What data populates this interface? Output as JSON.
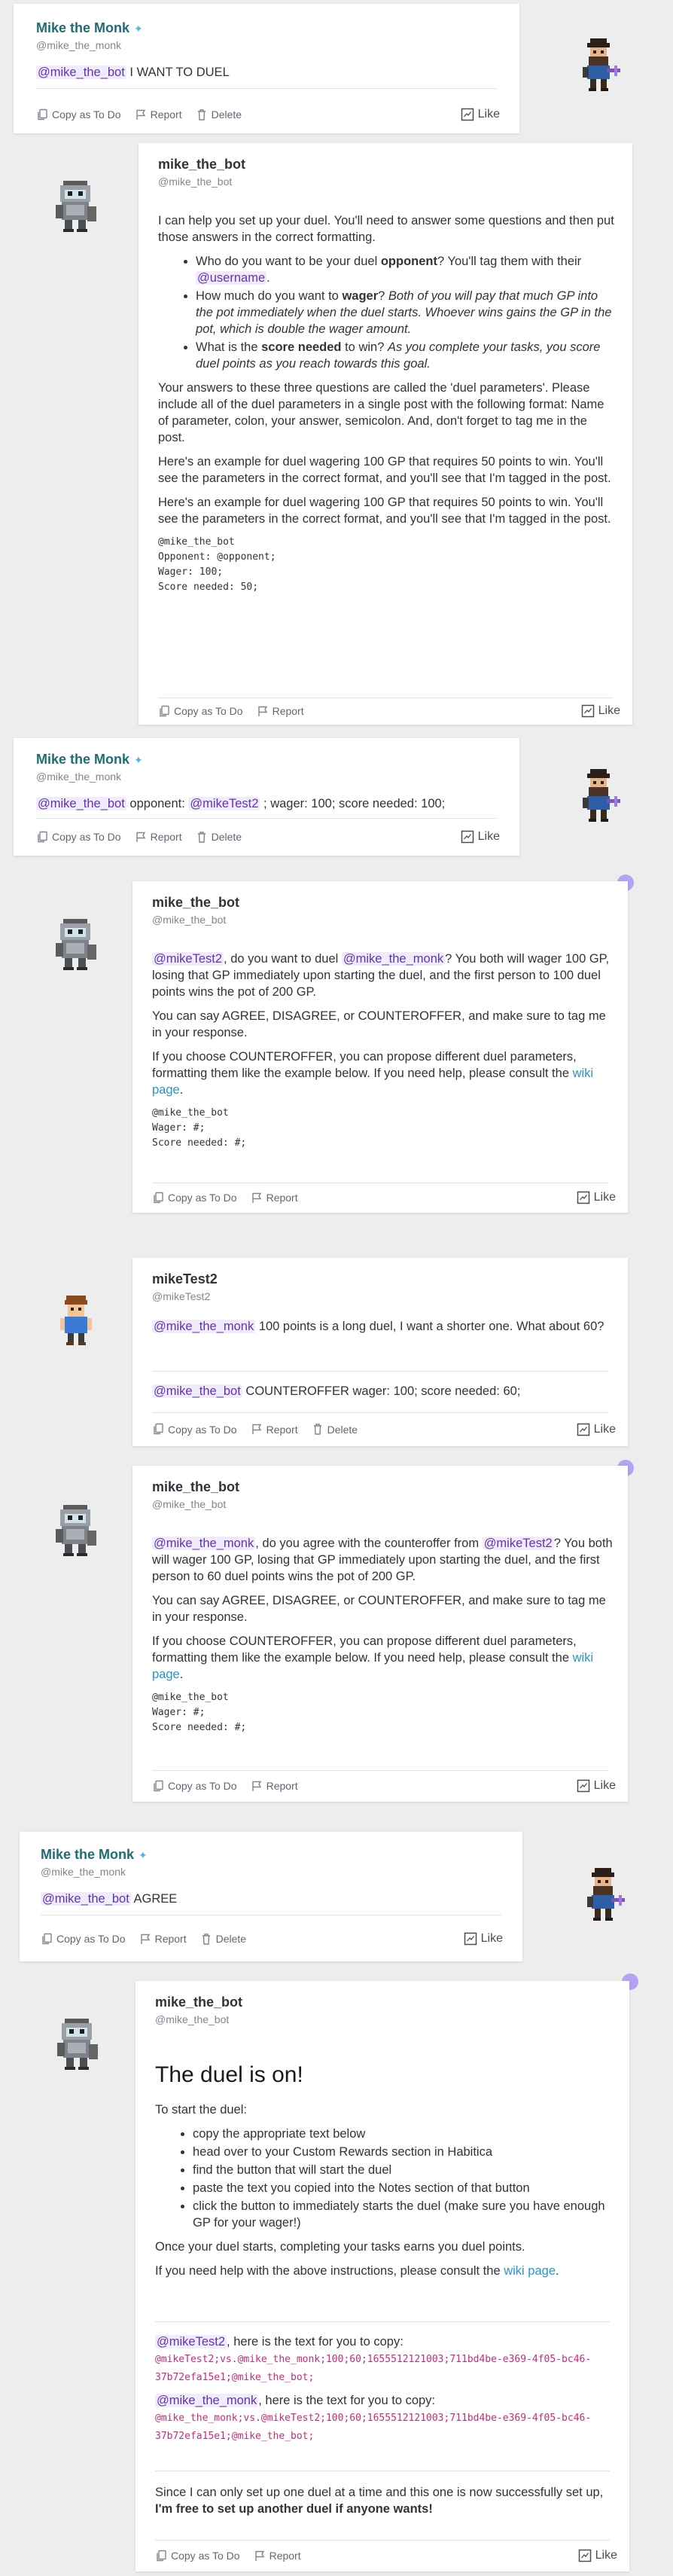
{
  "actions": {
    "copy": "Copy as To Do",
    "report": "Report",
    "delete": "Delete",
    "like": "Like"
  },
  "messages": {
    "m1": {
      "name": "Mike the Monk",
      "handle": "@mike_the_monk",
      "mention": "@mike_the_bot",
      "text": " I WANT TO DUEL"
    },
    "m2": {
      "name": "mike_the_bot",
      "handle": "@mike_the_bot",
      "p1": "I can help you set up your duel. You'll need to answer some questions and then put those answers in the correct formatting.",
      "b1_pre": "Who do you want to be your duel ",
      "b1_bold": "opponent",
      "b1_post": "? You'll tag them with their ",
      "b1_mention": "@username",
      "b1_end": ".",
      "b2_pre": "How much do you want to ",
      "b2_bold": "wager",
      "b2_post": "? ",
      "b2_ital": "Both of you will pay that much GP into the pot immediately when the duel starts. Whoever wins gains the GP in the pot, which is double the wager amount.",
      "b3_pre": "What is the ",
      "b3_bold": "score needed",
      "b3_post": " to win? ",
      "b3_ital": "As you complete your tasks, you score duel points as you reach towards this goal.",
      "p2": "Your answers to these three questions are called the 'duel parameters'. Please include all of the duel parameters in a single post with the following format: Name of parameter, colon, your answer, semicolon. And, don't forget to tag me in the post.",
      "p3": "Here's an example for duel wagering 100 GP that requires 50 points to win. You'll see the parameters in the correct format, and you'll see that I'm tagged in the post.",
      "p4": "Here's an example for duel wagering 100 GP that requires 50 points to win. You'll see the parameters in the correct format, and you'll see that I'm tagged in the post.",
      "code": "@mike_the_bot\nOpponent: @opponent;\nWager: 100;\nScore needed: 50;"
    },
    "m3": {
      "name": "Mike the Monk",
      "handle": "@mike_the_monk",
      "mention1": "@mike_the_bot",
      "t1": " opponent: ",
      "mention2": "@mikeTest2",
      "t2": " ; wager: 100; score needed: 100;"
    },
    "m4": {
      "name": "mike_the_bot",
      "handle": "@mike_the_bot",
      "mention1": "@mikeTest2",
      "t1": ", do you want to duel ",
      "mention2": "@mike_the_monk",
      "t2": "? You both will wager 100 GP, losing that GP immediately upon starting the duel, and the first person to 100 duel points wins the pot of 200 GP.",
      "p2": "You can say AGREE, DISAGREE, or COUNTEROFFER, and make sure to tag me in your response.",
      "p3": "If you choose COUNTEROFFER, you can propose different duel parameters, formatting them like the example below. If you need help, please consult the ",
      "link": "wiki page",
      "p3end": ".",
      "code": "@mike_the_bot\nWager: #;\nScore needed: #;"
    },
    "m5": {
      "name": "mikeTest2",
      "handle": "@mikeTest2",
      "mention1": "@mike_the_monk",
      "t1": " 100 points is a long duel, I want a shorter one. What about 60?",
      "mention2": "@mike_the_bot",
      "t2": " COUNTEROFFER wager: 100; score needed: 60;"
    },
    "m6": {
      "name": "mike_the_bot",
      "handle": "@mike_the_bot",
      "mention1": "@mike_the_monk",
      "t1": ", do you agree with the counteroffer from ",
      "mention2": "@mikeTest2",
      "t2": "? You both will wager 100 GP, losing that GP immediately upon starting the duel, and the first person to 60 duel points wins the pot of 200 GP.",
      "p2": "You can say AGREE, DISAGREE, or COUNTEROFFER, and make sure to tag me in your response.",
      "p3": "If you choose COUNTEROFFER, you can propose different duel parameters, formatting them like the example below. If you need help, please consult the ",
      "link": "wiki page",
      "p3end": ".",
      "code": "@mike_the_bot\nWager: #;\nScore needed: #;"
    },
    "m7": {
      "name": "Mike the Monk",
      "handle": "@mike_the_monk",
      "mention": "@mike_the_bot",
      "text": " AGREE"
    },
    "m8": {
      "name": "mike_the_bot",
      "handle": "@mike_the_bot",
      "heading": "The duel is on!",
      "intro": "To start the duel:",
      "steps": [
        "copy the appropriate text below",
        "head over to your Custom Rewards section in Habitica",
        "find the button that will start the duel",
        "paste the text you copied into the Notes section of that button",
        "click the button to immediately starts the duel (make sure you have enough GP for your wager!)"
      ],
      "p2": "Once your duel starts, completing your tasks earns you duel points.",
      "p3": "If you need help with the above instructions, please consult the ",
      "link": "wiki page",
      "p3end": ".",
      "c1_mention": "@mikeTest2",
      "c1_text": ", here is the text for you to copy: ",
      "c1_code": "@mikeTest2;vs.@mike_the_monk;100;60;1655512121003;711bd4be-e369-4f05-bc46-37b72efa15e1;@mike_the_bot;",
      "c2_mention": "@mike_the_monk",
      "c2_text": ", here is the text for you to copy: ",
      "c2_code": "@mike_the_monk;vs.@mikeTest2;100;60;1655512121003;711bd4be-e369-4f05-bc46-37b72efa15e1;@mike_the_bot;",
      "final_pre": "Since I can only set up one duel at a time and this one is now successfully set up, ",
      "final_bold": "I'm free to set up another duel if anyone wants!"
    }
  }
}
